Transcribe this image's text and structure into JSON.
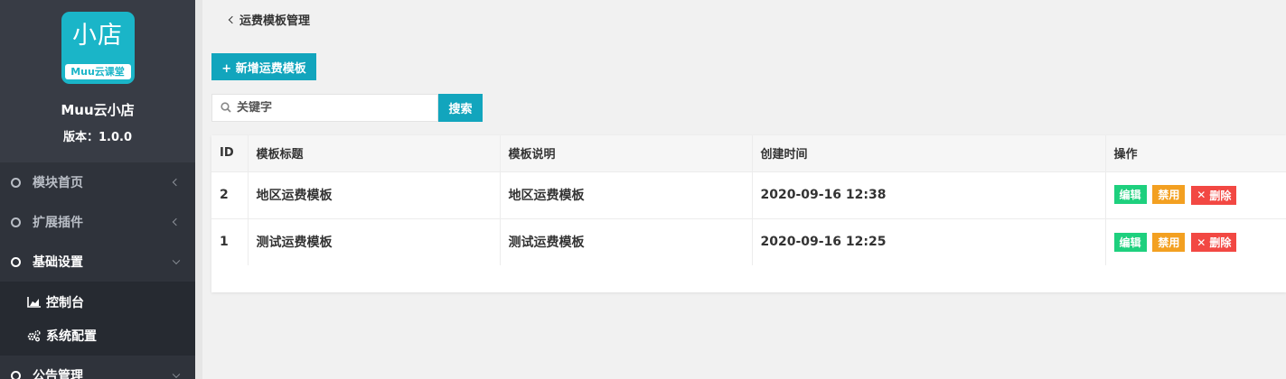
{
  "sidebar": {
    "logo_main": "小店",
    "logo_sub": "Muu云课堂",
    "app_name": "Muu云小店",
    "version": "版本：1.0.0",
    "menu": [
      {
        "label": "模块首页",
        "state": "collapsed"
      },
      {
        "label": "扩展插件",
        "state": "collapsed"
      },
      {
        "label": "基础设置",
        "state": "expanded"
      },
      {
        "label": "公告管理",
        "state": "expanded"
      }
    ],
    "submenu": [
      {
        "label": "控制台",
        "icon": "area-chart-icon"
      },
      {
        "label": "系统配置",
        "icon": "gears-icon"
      }
    ]
  },
  "main": {
    "breadcrumb": "运费模板管理",
    "add_button": "+ 新增运费模板",
    "search": {
      "placeholder": "关键字",
      "button": "搜索"
    },
    "table": {
      "headers": [
        "ID",
        "模板标题",
        "模板说明",
        "创建时间",
        "操作"
      ],
      "rows": [
        {
          "id": "2",
          "title": "地区运费模板",
          "desc": "地区运费模板",
          "time": "2020-09-16 12:38"
        },
        {
          "id": "1",
          "title": "测试运费模板",
          "desc": "测试运费模板",
          "time": "2020-09-16 12:25"
        }
      ],
      "actions": {
        "edit": "编辑",
        "disable": "禁用",
        "delete": "删除"
      }
    }
  },
  "colors": {
    "sidebar_bg": "#2f333b",
    "accent": "#12a5bd",
    "edit": "#1ed07e",
    "disable": "#f3a021",
    "delete": "#f24843"
  }
}
